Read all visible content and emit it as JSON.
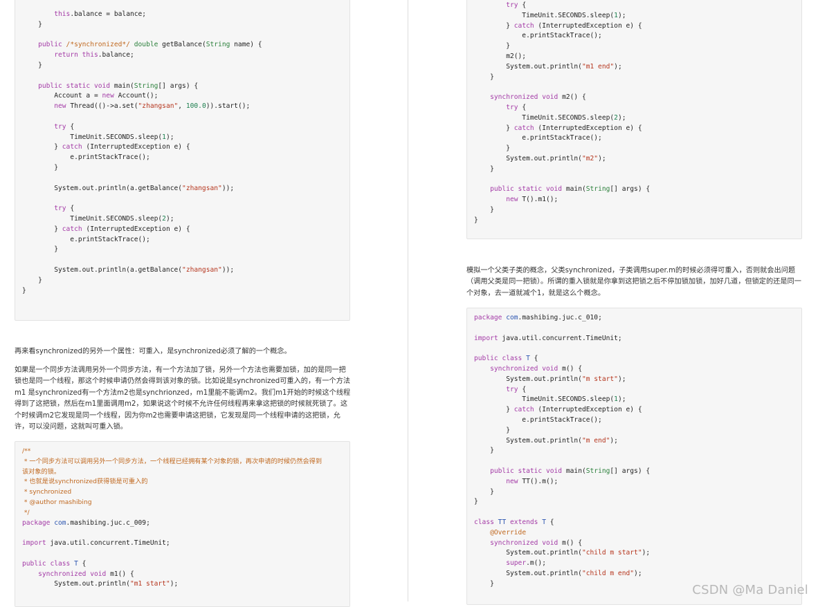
{
  "left": {
    "code_block_1": [
      "        this.balance = balance;",
      "    }",
      "",
      "    public /*synchronized*/ double getBalance(String name) {",
      "        return this.balance;",
      "    }",
      "",
      "    public static void main(String[] args) {",
      "        Account a = new Account();",
      "        new Thread(()->a.set(\"zhangsan\", 100.0)).start();",
      "",
      "        try {",
      "            TimeUnit.SECONDS.sleep(1);",
      "        } catch (InterruptedException e) {",
      "            e.printStackTrace();",
      "        }",
      "",
      "        System.out.println(a.getBalance(\"zhangsan\"));",
      "",
      "        try {",
      "            TimeUnit.SECONDS.sleep(2);",
      "        } catch (InterruptedException e) {",
      "            e.printStackTrace();",
      "        }",
      "",
      "        System.out.println(a.getBalance(\"zhangsan\"));",
      "    }",
      "}"
    ],
    "para_1": "再来看synchronized的另外一个属性：可重入，是synchronized必须了解的一个概念。",
    "para_2": "如果是一个同步方法调用另外一个同步方法，有一个方法加了锁，另外一个方法也需要加锁，加的是同一把锁也是同一个线程，那这个时候申请仍然会得到该对象的锁。比如说是synchronized可重入的，有一个方法m1 是synchronized有一个方法m2也是synchrionzed，m1里能不能调m2。我们m1开始的时候这个线程得到了这把锁，然后在m1里面调用m2，如果说这个时候不允许任何线程再来拿这把锁的时候就死锁了。这个时候调m2它发现是同一个线程，因为你m2也需要申请这把锁，它发现是同一个线程申请的这把锁，允许，可以没问题，这就叫可重入锁。",
    "code_block_2": [
      "/**",
      " * 一个同步方法可以调用另外一个同步方法，一个线程已经拥有某个对象的锁，再次申请的时候仍然会得到",
      "该对象的锁。",
      " * 也就是说synchronized获得锁是可重入的",
      " * synchronized",
      " * @author mashibing",
      " */",
      "package com.mashibing.juc.c_009;",
      "",
      "import java.util.concurrent.TimeUnit;",
      "",
      "public class T {",
      "    synchronized void m1() {",
      "        System.out.println(\"m1 start\");"
    ]
  },
  "right": {
    "code_block_1": [
      "        try {",
      "            TimeUnit.SECONDS.sleep(1);",
      "        } catch (InterruptedException e) {",
      "            e.printStackTrace();",
      "        }",
      "        m2();",
      "        System.out.println(\"m1 end\");",
      "    }",
      "",
      "    synchronized void m2() {",
      "        try {",
      "            TimeUnit.SECONDS.sleep(2);",
      "        } catch (InterruptedException e) {",
      "            e.printStackTrace();",
      "        }",
      "        System.out.println(\"m2\");",
      "    }",
      "",
      "    public static void main(String[] args) {",
      "        new T().m1();",
      "    }",
      "}"
    ],
    "para_1": "模拟一个父类子类的概念，父类synchronized，子类调用super.m的时候必须得可重入，否则就会出问题（调用父类是同一把锁）。所谓的重入锁就是你拿到这把锁之后不停加锁加锁，加好几道，但锁定的还是同一个对象，去一道就减个1，就是这么个概念。",
    "code_block_2": [
      "package com.mashibing.juc.c_010;",
      "",
      "import java.util.concurrent.TimeUnit;",
      "",
      "public class T {",
      "    synchronized void m() {",
      "        System.out.println(\"m start\");",
      "        try {",
      "            TimeUnit.SECONDS.sleep(1);",
      "        } catch (InterruptedException e) {",
      "            e.printStackTrace();",
      "        }",
      "        System.out.println(\"m end\");",
      "    }",
      "",
      "    public static void main(String[] args) {",
      "        new TT().m();",
      "    }",
      "}",
      "",
      "class TT extends T {",
      "    @Override",
      "    synchronized void m() {",
      "        System.out.println(\"child m start\");",
      "        super.m();",
      "        System.out.println(\"child m end\");",
      "    }"
    ]
  },
  "watermark": "CSDN @Ma Daniel"
}
